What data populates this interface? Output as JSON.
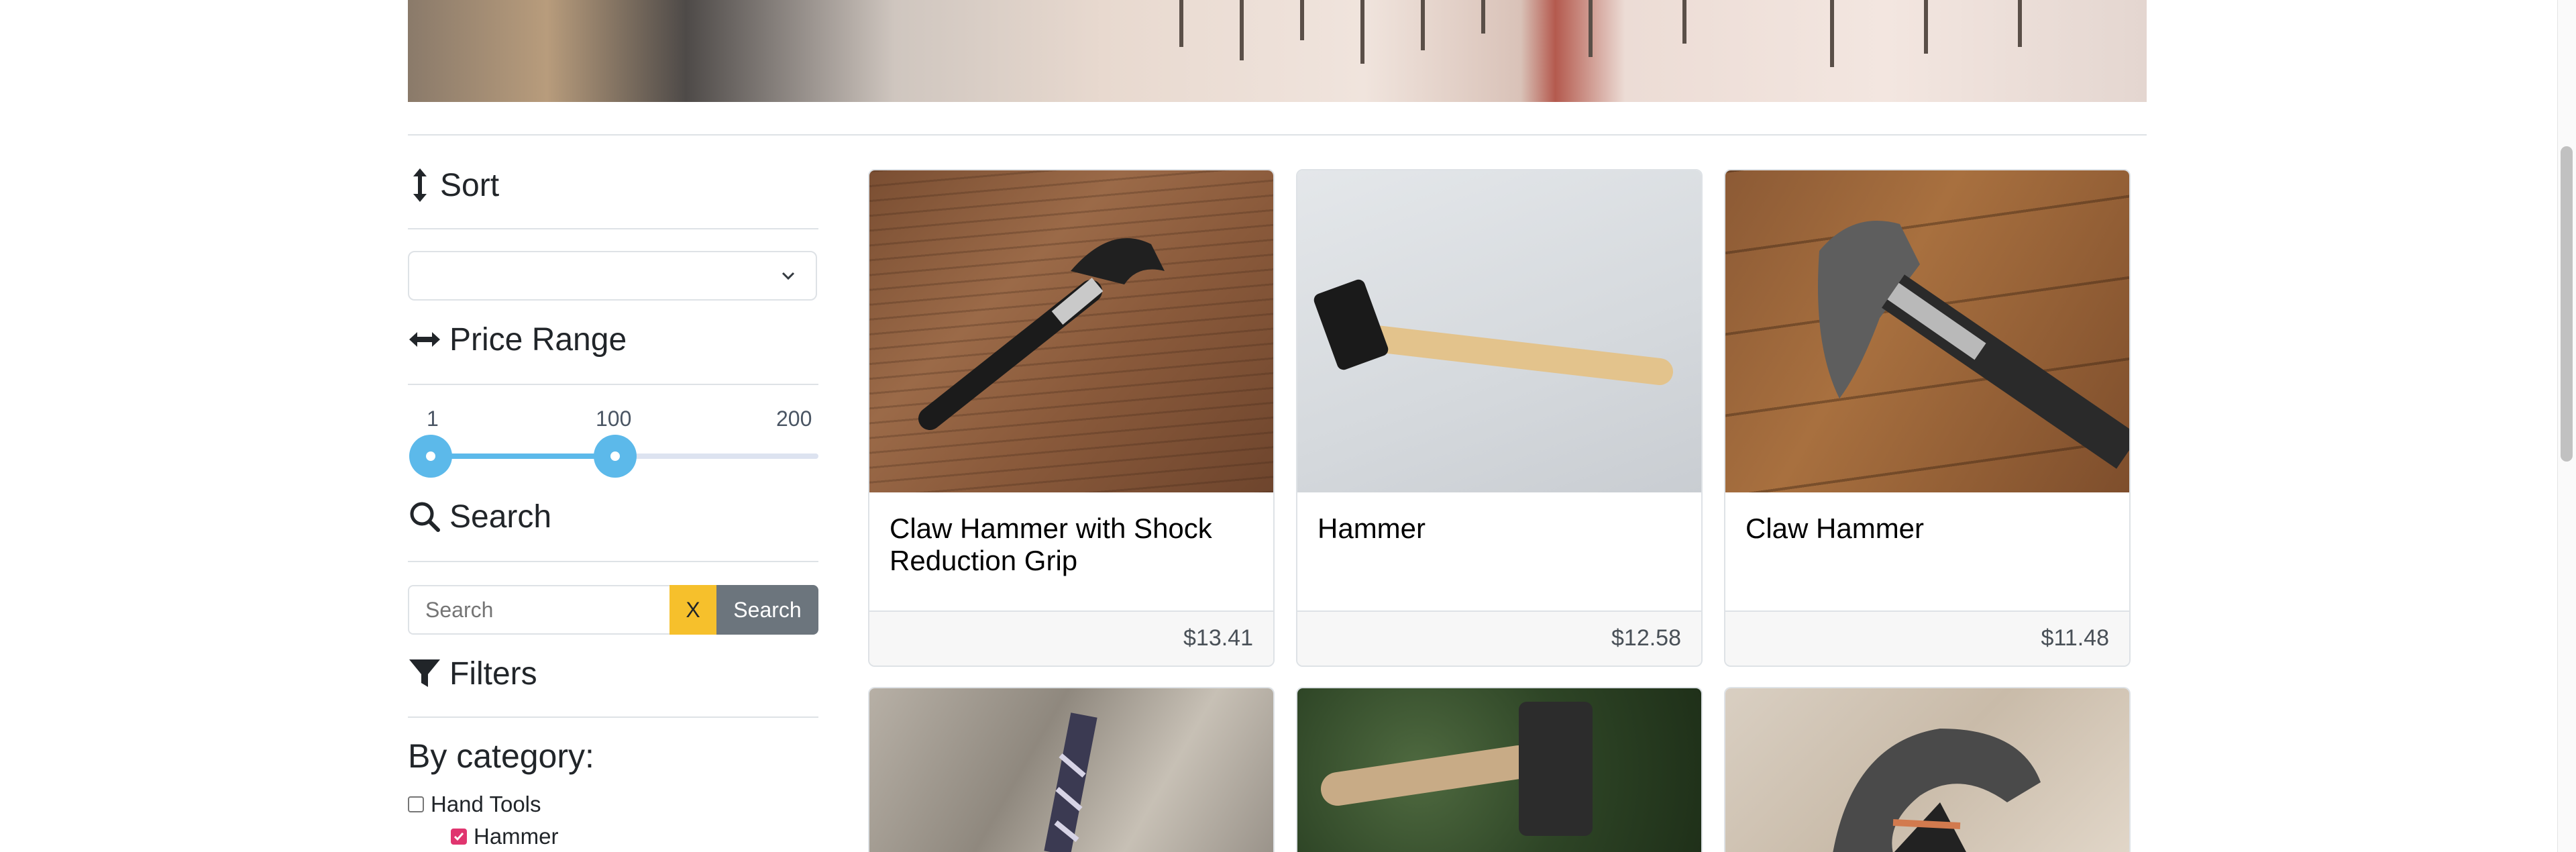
{
  "sidebar": {
    "sort": {
      "heading": "Sort",
      "icon": "arrows-vertical-icon",
      "selected": ""
    },
    "price_range": {
      "heading": "Price Range",
      "icon": "arrows-horizontal-icon",
      "min_label": "1",
      "value_label": "100",
      "max_label": "200",
      "min": 1,
      "max": 200,
      "selected_low": 1,
      "selected_high": 100
    },
    "search": {
      "heading": "Search",
      "icon": "search-icon",
      "placeholder": "Search",
      "clear_label": "X",
      "button_label": "Search"
    },
    "filters": {
      "heading": "Filters",
      "icon": "filter-icon",
      "by_category": "By category:",
      "categories": [
        {
          "label": "Hand Tools",
          "checked": false
        },
        {
          "label": "Hammer",
          "checked": true
        }
      ]
    }
  },
  "products": [
    {
      "title": "Claw Hammer with Shock Reduction Grip",
      "price": "$13.41"
    },
    {
      "title": "Hammer",
      "price": "$12.58"
    },
    {
      "title": "Claw Hammer",
      "price": "$11.48"
    }
  ],
  "colors": {
    "accent": "#5cb9ea",
    "clear_button": "#f6c02c",
    "search_button": "#6c757d",
    "checkbox_checked": "#e0356f"
  }
}
